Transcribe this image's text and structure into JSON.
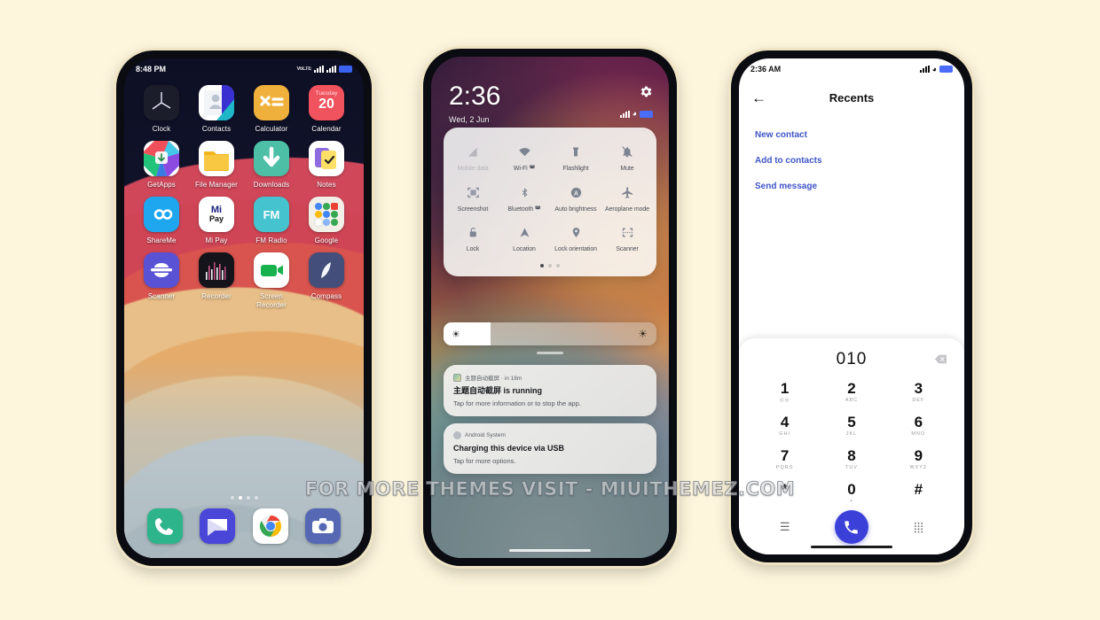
{
  "background_color": "#fdf5dc",
  "watermark": {
    "text": "FOR MORE THEMES VISIT - MIUITHEMEZ.COM"
  },
  "phone_home": {
    "status": {
      "time": "8:48 PM",
      "network": "LTE",
      "battery_icon": "battery-icon",
      "signal_icon": "signal-icon"
    },
    "apps": [
      [
        {
          "label": "Clock",
          "icon": "clock-app-icon"
        },
        {
          "label": "Contacts",
          "icon": "contacts-app-icon"
        },
        {
          "label": "Calculator",
          "icon": "calculator-app-icon"
        },
        {
          "label": "Calendar",
          "icon": "calendar-app-icon",
          "weekday": "Tuesday",
          "day": "20"
        }
      ],
      [
        {
          "label": "GetApps",
          "icon": "getapps-app-icon"
        },
        {
          "label": "File Manager",
          "icon": "file-manager-app-icon"
        },
        {
          "label": "Downloads",
          "icon": "downloads-app-icon"
        },
        {
          "label": "Notes",
          "icon": "notes-app-icon"
        }
      ],
      [
        {
          "label": "ShareMe",
          "icon": "shareme-app-icon"
        },
        {
          "label": "Mi Pay",
          "icon": "mipay-app-icon",
          "text1": "Mi",
          "text2": "Pay"
        },
        {
          "label": "FM Radio",
          "icon": "fm-radio-app-icon",
          "text": "FM"
        },
        {
          "label": "Google",
          "icon": "google-folder-icon"
        }
      ],
      [
        {
          "label": "Scanner",
          "icon": "scanner-app-icon"
        },
        {
          "label": "Recorder",
          "icon": "recorder-app-icon"
        },
        {
          "label": "Screen Recorder",
          "icon": "screen-recorder-app-icon"
        },
        {
          "label": "Compass",
          "icon": "compass-app-icon"
        }
      ]
    ],
    "page_dots": {
      "count": 4,
      "active_index": 1
    },
    "dock": [
      {
        "label": "Phone",
        "icon": "phone-dock-icon"
      },
      {
        "label": "Messages",
        "icon": "messages-dock-icon"
      },
      {
        "label": "Chrome",
        "icon": "chrome-dock-icon"
      },
      {
        "label": "Camera",
        "icon": "camera-dock-icon"
      }
    ]
  },
  "phone_control_center": {
    "time": "2:36",
    "date": "Wed, 2 Jun",
    "settings_icon": "gear-icon",
    "tiles": [
      {
        "label": "Mobile data",
        "icon": "mobile-data-icon",
        "state": "off"
      },
      {
        "label": "Wi-Fi",
        "icon": "wifi-icon",
        "state": "on"
      },
      {
        "label": "Flashlight",
        "icon": "flashlight-icon",
        "state": "on"
      },
      {
        "label": "Mute",
        "icon": "mute-icon",
        "state": "on"
      },
      {
        "label": "Screenshot",
        "icon": "screenshot-icon",
        "state": "on"
      },
      {
        "label": "Bluetooth",
        "icon": "bluetooth-icon",
        "state": "on"
      },
      {
        "label": "Auto brightness",
        "icon": "auto-brightness-icon",
        "state": "on"
      },
      {
        "label": "Aeroplane mode",
        "icon": "aeroplane-mode-icon",
        "state": "on"
      },
      {
        "label": "Lock",
        "icon": "lock-icon",
        "state": "on"
      },
      {
        "label": "Location",
        "icon": "location-icon",
        "state": "on"
      },
      {
        "label": "Lock orientation",
        "icon": "lock-orientation-icon",
        "state": "on"
      },
      {
        "label": "Scanner",
        "icon": "scanner-icon",
        "state": "on"
      }
    ],
    "panel_dots": {
      "count": 3,
      "active_index": 0
    },
    "brightness": {
      "value_percent": 22,
      "low_icon": "brightness-low-icon",
      "high_icon": "brightness-high-icon"
    },
    "notifications": [
      {
        "app": "主题自动截屏 · in 18m",
        "title": "主题自动截屏 is running",
        "body": "Tap for more information or to stop the app.",
        "icon": "theme-screenshot-icon"
      },
      {
        "app": "Android System",
        "title": "Charging this device via USB",
        "body": "Tap for more options.",
        "icon": "android-system-icon"
      }
    ]
  },
  "phone_dialer": {
    "status": {
      "time": "2:36 AM"
    },
    "back_icon": "back-arrow-icon",
    "title": "Recents",
    "links": [
      {
        "label": "New contact"
      },
      {
        "label": "Add to contacts"
      },
      {
        "label": "Send message"
      }
    ],
    "entered_number": "010",
    "backspace_icon": "backspace-icon",
    "keys": [
      {
        "digit": "1",
        "sub": ""
      },
      {
        "digit": "2",
        "sub": "ABC"
      },
      {
        "digit": "3",
        "sub": "DEF"
      },
      {
        "digit": "4",
        "sub": "GHI"
      },
      {
        "digit": "5",
        "sub": "JKL"
      },
      {
        "digit": "6",
        "sub": "MNO"
      },
      {
        "digit": "7",
        "sub": "PQRS"
      },
      {
        "digit": "8",
        "sub": "TUV"
      },
      {
        "digit": "9",
        "sub": "WXYZ"
      },
      {
        "digit": "*",
        "sub": ""
      },
      {
        "digit": "0",
        "sub": "+"
      },
      {
        "digit": "#",
        "sub": ""
      }
    ],
    "bottom": {
      "menu_icon": "menu-icon",
      "call_icon": "call-icon",
      "keypad_icon": "keypad-icon",
      "call_button_color": "#3b41d8"
    }
  }
}
